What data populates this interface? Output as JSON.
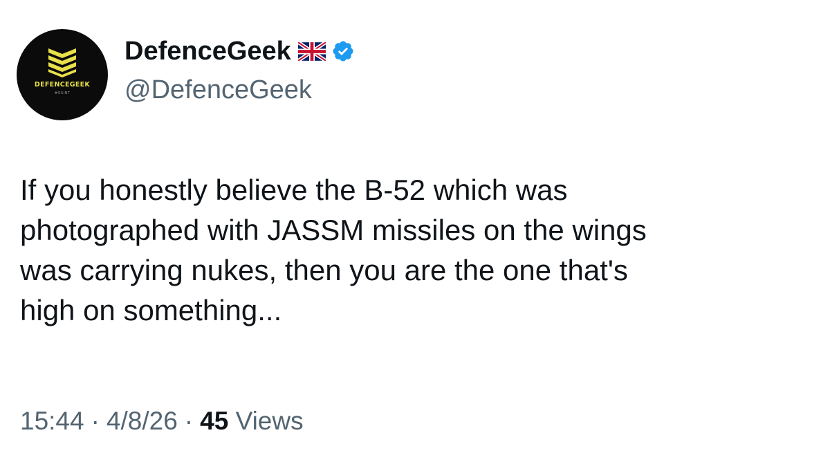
{
  "account": {
    "display_name": "DefenceGeek",
    "handle": "@DefenceGeek",
    "flag_icon": "united-kingdom-flag-icon",
    "verified_icon": "verified-badge-icon",
    "verified_color": "#1d9bf0",
    "avatar": {
      "logo_text": "DEFENCEGEEK",
      "logo_subtext": "#OSINT",
      "logo_color": "#e8e04a",
      "background": "#0b0b0b"
    }
  },
  "tweet": {
    "text": "If you honestly believe the B-52 which was\nphotographed with JASSM missiles on the wings\nwas carrying nukes, then you are the one that's\nhigh on something...",
    "time": "15:44",
    "date": "4/8/26",
    "separator": "·",
    "views_count": "45",
    "views_label": "Views"
  },
  "colors": {
    "text_primary": "#0f1419",
    "text_secondary": "#536471"
  }
}
